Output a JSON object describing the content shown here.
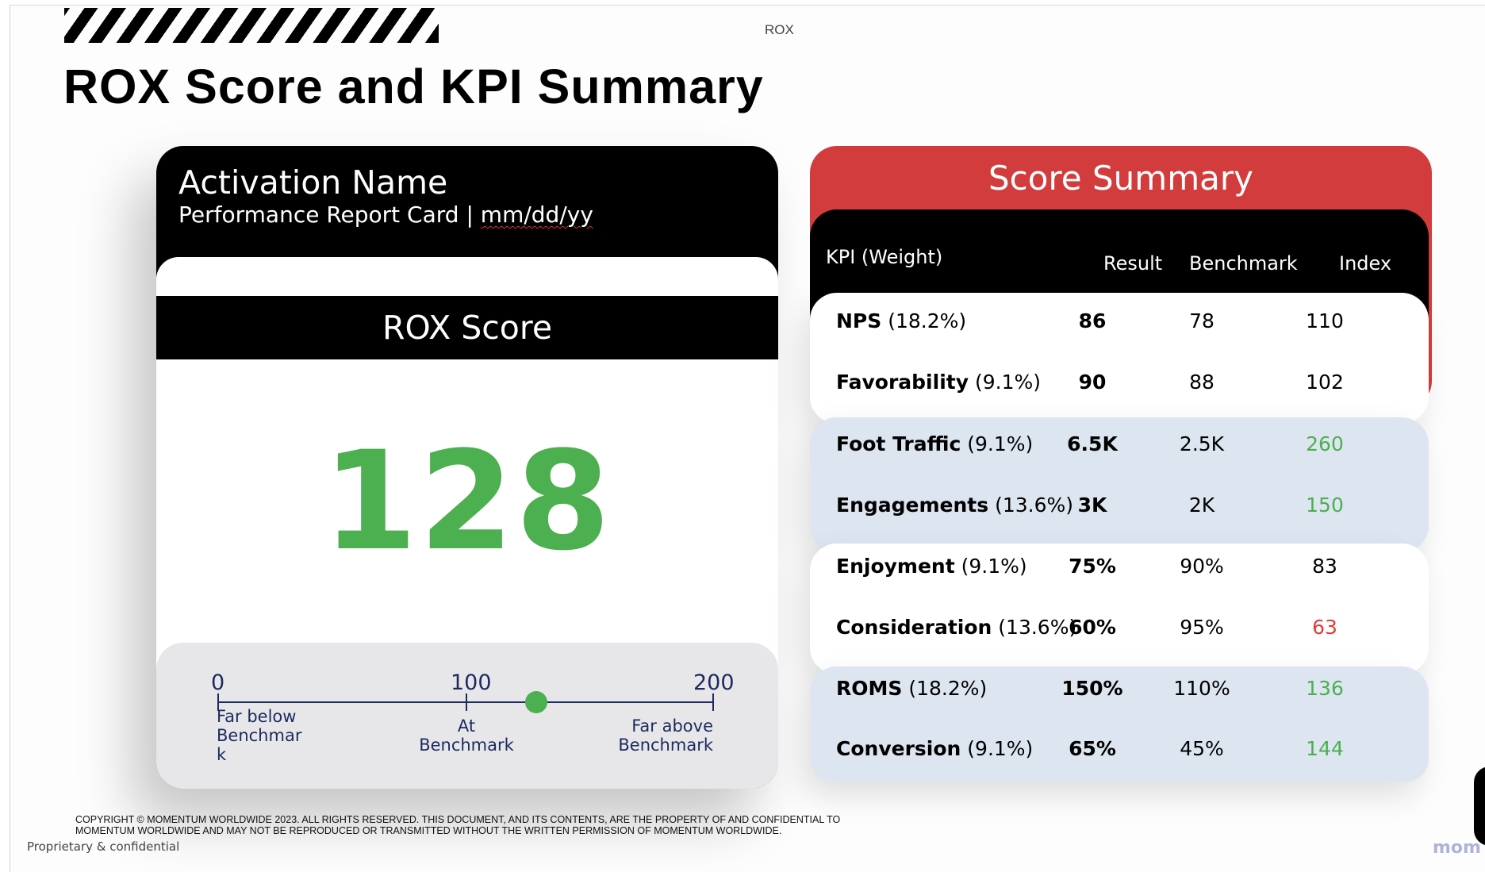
{
  "slide": {
    "top_label": "ROX",
    "title": "ROX Score and KPI Summary"
  },
  "activation": {
    "name": "Activation Name",
    "subtitle_prefix": "Performance Report Card | ",
    "date": "mm/dd/yy"
  },
  "rox": {
    "label": "ROX Score",
    "score": "128",
    "score_value": 128,
    "gauge": {
      "min_label": "0",
      "mid_label": "100",
      "max_label": "200",
      "left_caption_lines": [
        "Far below",
        "Benchmar",
        "k"
      ],
      "mid_caption_lines": [
        "At",
        "Benchmark"
      ],
      "right_caption_lines": [
        "Far above",
        "Benchmark"
      ]
    }
  },
  "summary": {
    "title": "Score Summary",
    "headers": {
      "kpi": "KPI (Weight)",
      "result": "Result",
      "benchmark": "Benchmark",
      "index": "Index"
    },
    "rows": [
      {
        "kpi": "NPS",
        "weight": "(18.2%)",
        "result": "86",
        "benchmark": "78",
        "index": "110",
        "index_color": "#000000"
      },
      {
        "kpi": "Favorability",
        "weight": "(9.1%)",
        "result": "90",
        "benchmark": "88",
        "index": "102",
        "index_color": "#000000"
      },
      {
        "kpi": "Foot Traffic",
        "weight": "(9.1%)",
        "result": "6.5K",
        "benchmark": "2.5K",
        "index": "260",
        "index_color": "#4caf50"
      },
      {
        "kpi": "Engagements",
        "weight": "(13.6%)",
        "result": "3K",
        "benchmark": "2K",
        "index": "150",
        "index_color": "#4caf50"
      },
      {
        "kpi": "Enjoyment",
        "weight": "(9.1%)",
        "result": "75%",
        "benchmark": "90%",
        "index": "83",
        "index_color": "#000000"
      },
      {
        "kpi": "Consideration",
        "weight": "(13.6%)",
        "result": "60%",
        "benchmark": "95%",
        "index": "63",
        "index_color": "#e53935"
      },
      {
        "kpi": "ROMS",
        "weight": "(18.2%)",
        "result": "150%",
        "benchmark": "110%",
        "index": "136",
        "index_color": "#4caf50"
      },
      {
        "kpi": "Conversion",
        "weight": "(9.1%)",
        "result": "65%",
        "benchmark": "45%",
        "index": "144",
        "index_color": "#4caf50"
      }
    ]
  },
  "footer": {
    "copyright_line1": "COPYRIGHT © MOMENTUM WORLDWIDE 2023. ALL RIGHTS RESERVED. THIS DOCUMENT, AND ITS CONTENTS, ARE THE PROPERTY OF AND CONFIDENTIAL TO",
    "copyright_line2": "MOMENTUM WORLDWIDE AND MAY NOT BE REPRODUCED OR TRANSMITTED WITHOUT THE WRITTEN PERMISSION OF MOMENTUM WORLDWIDE.",
    "confidential": "Proprietary & confidential",
    "brand_partial": "mom"
  }
}
